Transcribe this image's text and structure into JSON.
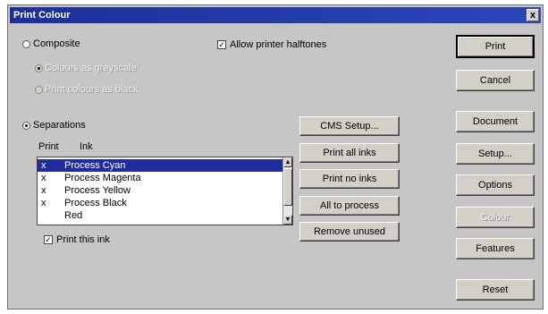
{
  "window": {
    "title": "Print Colour",
    "close_glyph": "x"
  },
  "options": {
    "composite": "Composite",
    "grayscale": "Colours as greyscale",
    "black": "Print colours as black",
    "separations": "Separations",
    "allow_halftones": "Allow printer halftones",
    "print_this_ink": "Print this ink"
  },
  "list": {
    "headers": {
      "print": "Print",
      "ink": "Ink"
    },
    "rows": [
      {
        "mark": "x",
        "name": "Process Cyan"
      },
      {
        "mark": "x",
        "name": "Process Magenta"
      },
      {
        "mark": "x",
        "name": "Process Yellow"
      },
      {
        "mark": "x",
        "name": "Process Black"
      },
      {
        "mark": "",
        "name": "Red"
      }
    ]
  },
  "middle_buttons": {
    "cms_setup": "CMS Setup...",
    "print_all": "Print all inks",
    "print_none": "Print no inks",
    "all_process": "All to process",
    "remove_unused": "Remove unused"
  },
  "right_buttons": {
    "print": "Print",
    "cancel": "Cancel",
    "document": "Document",
    "setup": "Setup...",
    "options": "Options",
    "colour": "Colour",
    "features": "Features",
    "reset": "Reset"
  }
}
